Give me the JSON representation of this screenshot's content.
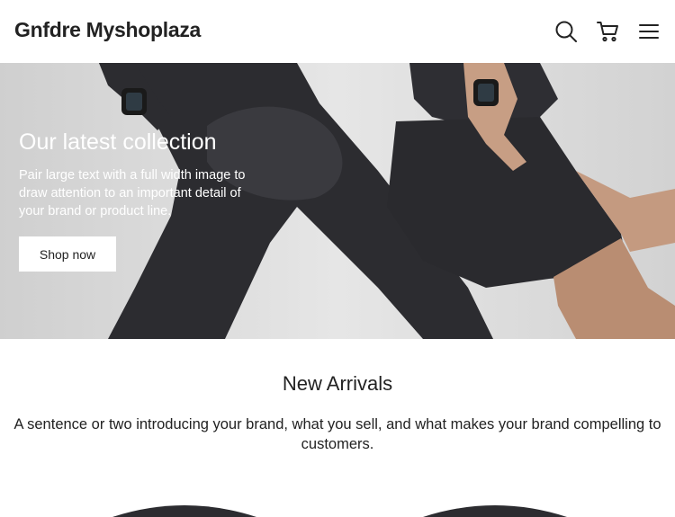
{
  "header": {
    "logo": "Gnfdre Myshoplaza",
    "icons": [
      "search-icon",
      "cart-icon",
      "menu-icon"
    ]
  },
  "hero": {
    "title": "Our latest collection",
    "text": "Pair large text with a full width image to draw attention to an important detail of your brand or product line.",
    "button_label": "Shop now"
  },
  "arrivals": {
    "title": "New Arrivals",
    "text": "A sentence or two introducing your brand, what you sell, and what makes your brand compelling to customers."
  },
  "colors": {
    "text": "#222222",
    "hero_bg": "#dcdcdc",
    "button_bg": "#ffffff"
  }
}
